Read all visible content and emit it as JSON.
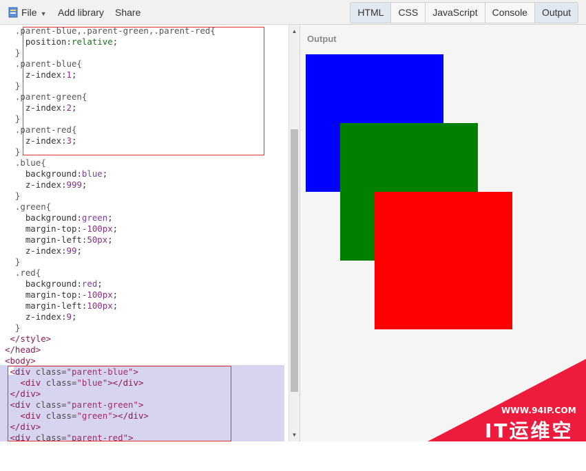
{
  "menu": {
    "file_label": "File",
    "add_library_label": "Add library",
    "share_label": "Share"
  },
  "view_tabs": [
    {
      "label": "HTML",
      "active": true
    },
    {
      "label": "CSS",
      "active": false
    },
    {
      "label": "JavaScript",
      "active": false
    },
    {
      "label": "Console",
      "active": false
    },
    {
      "label": "Output",
      "active": true
    }
  ],
  "code_lines": [
    [
      [
        "  .parent-blue,.parent-green,.parent-red{",
        "sel"
      ]
    ],
    [
      [
        "    position",
        "prop"
      ],
      [
        ":",
        "prop"
      ],
      [
        "relative",
        "val"
      ],
      [
        ";",
        "prop"
      ]
    ],
    [
      [
        "  }",
        "sel"
      ]
    ],
    [
      [
        "  .parent-blue{",
        "sel"
      ]
    ],
    [
      [
        "    z-index",
        "prop"
      ],
      [
        ":",
        "prop"
      ],
      [
        "1",
        "num"
      ],
      [
        ";",
        "prop"
      ]
    ],
    [
      [
        "  }",
        "sel"
      ]
    ],
    [
      [
        "  .parent-green{",
        "sel"
      ]
    ],
    [
      [
        "    z-index",
        "prop"
      ],
      [
        ":",
        "prop"
      ],
      [
        "2",
        "num"
      ],
      [
        ";",
        "prop"
      ]
    ],
    [
      [
        "  }",
        "sel"
      ]
    ],
    [
      [
        "  .parent-red{",
        "sel"
      ]
    ],
    [
      [
        "    z-index",
        "prop"
      ],
      [
        ":",
        "prop"
      ],
      [
        "3",
        "num"
      ],
      [
        ";",
        "prop"
      ]
    ],
    [
      [
        "  }",
        "sel"
      ]
    ],
    [
      [
        "  .blue{",
        "sel"
      ]
    ],
    [
      [
        "    background",
        "prop"
      ],
      [
        ":",
        "prop"
      ],
      [
        "blue",
        "key"
      ],
      [
        ";",
        "prop"
      ]
    ],
    [
      [
        "    z-index",
        "prop"
      ],
      [
        ":",
        "prop"
      ],
      [
        "999",
        "num"
      ],
      [
        ";",
        "prop"
      ]
    ],
    [
      [
        "  }",
        "sel"
      ]
    ],
    [
      [
        "  .green{",
        "sel"
      ]
    ],
    [
      [
        "    background",
        "prop"
      ],
      [
        ":",
        "prop"
      ],
      [
        "green",
        "key"
      ],
      [
        ";",
        "prop"
      ]
    ],
    [
      [
        "    margin-top",
        "prop"
      ],
      [
        ":",
        "prop"
      ],
      [
        "-100px",
        "num"
      ],
      [
        ";",
        "prop"
      ]
    ],
    [
      [
        "    margin-left",
        "prop"
      ],
      [
        ":",
        "prop"
      ],
      [
        "50px",
        "num"
      ],
      [
        ";",
        "prop"
      ]
    ],
    [
      [
        "    z-index",
        "prop"
      ],
      [
        ":",
        "prop"
      ],
      [
        "99",
        "num"
      ],
      [
        ";",
        "prop"
      ]
    ],
    [
      [
        "  }",
        "sel"
      ]
    ],
    [
      [
        "  .red{",
        "sel"
      ]
    ],
    [
      [
        "    background",
        "prop"
      ],
      [
        ":",
        "prop"
      ],
      [
        "red",
        "key"
      ],
      [
        ";",
        "prop"
      ]
    ],
    [
      [
        "    margin-top",
        "prop"
      ],
      [
        ":",
        "prop"
      ],
      [
        "-100px",
        "num"
      ],
      [
        ";",
        "prop"
      ]
    ],
    [
      [
        "    margin-left",
        "prop"
      ],
      [
        ":",
        "prop"
      ],
      [
        "100px",
        "num"
      ],
      [
        ";",
        "prop"
      ]
    ],
    [
      [
        "    z-index",
        "prop"
      ],
      [
        ":",
        "prop"
      ],
      [
        "9",
        "num"
      ],
      [
        ";",
        "prop"
      ]
    ],
    [
      [
        "  }",
        "sel"
      ]
    ],
    [
      [
        " </style>",
        "tag"
      ]
    ],
    [
      [
        "</head>",
        "tag"
      ]
    ],
    [
      [
        "<body>",
        "tag"
      ]
    ],
    [
      [
        " <div ",
        "tag"
      ],
      [
        "class=",
        "attr"
      ],
      [
        "\"parent-blue\"",
        "str"
      ],
      [
        ">",
        "tag"
      ]
    ],
    [
      [
        "   <div ",
        "tag"
      ],
      [
        "class=",
        "attr"
      ],
      [
        "\"blue\"",
        "str"
      ],
      [
        "></div>",
        "tag"
      ]
    ],
    [
      [
        " </div>",
        "tag"
      ]
    ],
    [
      [
        " <div ",
        "tag"
      ],
      [
        "class=",
        "attr"
      ],
      [
        "\"parent-green\"",
        "str"
      ],
      [
        ">",
        "tag"
      ]
    ],
    [
      [
        "   <div ",
        "tag"
      ],
      [
        "class=",
        "attr"
      ],
      [
        "\"green\"",
        "str"
      ],
      [
        "></div>",
        "tag"
      ]
    ],
    [
      [
        " </div>",
        "tag"
      ]
    ],
    [
      [
        " <div ",
        "tag"
      ],
      [
        "class=",
        "attr"
      ],
      [
        "\"parent-red\"",
        "str"
      ],
      [
        ">",
        "tag"
      ]
    ]
  ],
  "output": {
    "label": "Output",
    "blue_color": "#0000ff",
    "green_color": "#008000",
    "red_color": "#ff0000"
  },
  "watermark": {
    "url": "WWW.94IP.COM",
    "text": "IT运维空间"
  },
  "icons": {
    "file": "file-icon",
    "caret": "caret-down-icon",
    "scroll_up": "arrow-up-icon",
    "scroll_down": "arrow-down-icon"
  }
}
